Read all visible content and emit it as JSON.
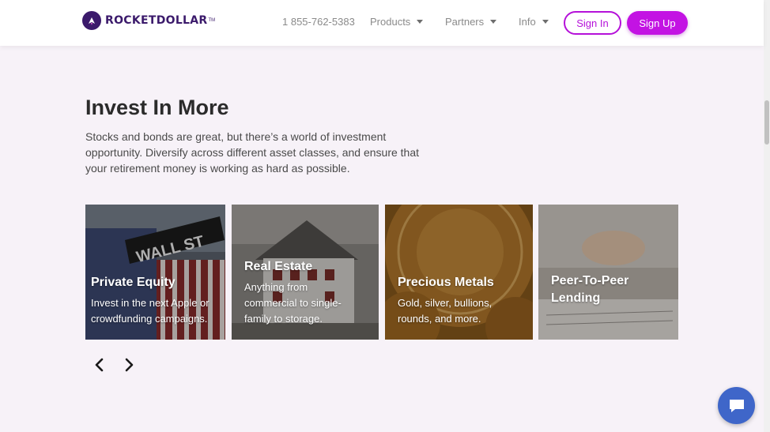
{
  "header": {
    "logo_text": "ROCKETDOLLAR",
    "logo_tm": "TM",
    "phone": "1 855-762-5383",
    "nav": [
      {
        "label": "Products"
      },
      {
        "label": "Partners"
      },
      {
        "label": "Info"
      }
    ],
    "sign_in": "Sign In",
    "sign_up": "Sign Up"
  },
  "main": {
    "title": "Invest In More",
    "subtitle": "Stocks and bonds are great, but there’s a world of investment opportunity. Diversify across different asset classes, and ensure that your retirement money is working as hard as possible.",
    "cards": [
      {
        "title": "Private Equity",
        "description": "Invest in the next Apple or crowdfunding campaigns."
      },
      {
        "title": "Real Estate",
        "description": "Anything from commercial to single-family to storage."
      },
      {
        "title": "Precious Metals",
        "description": "Gold, silver, bullions, rounds, and more."
      },
      {
        "title": "Peer-To-Peer Lending",
        "description": ""
      }
    ],
    "prev_icon": "chevron-left-icon",
    "next_icon": "chevron-right-icon"
  },
  "chat": {
    "icon": "chat-bubble-icon"
  },
  "colors": {
    "accent": "#c313e3",
    "brand": "#3b1a6b",
    "background": "#f7f2f8",
    "chat": "#3f66c9"
  }
}
